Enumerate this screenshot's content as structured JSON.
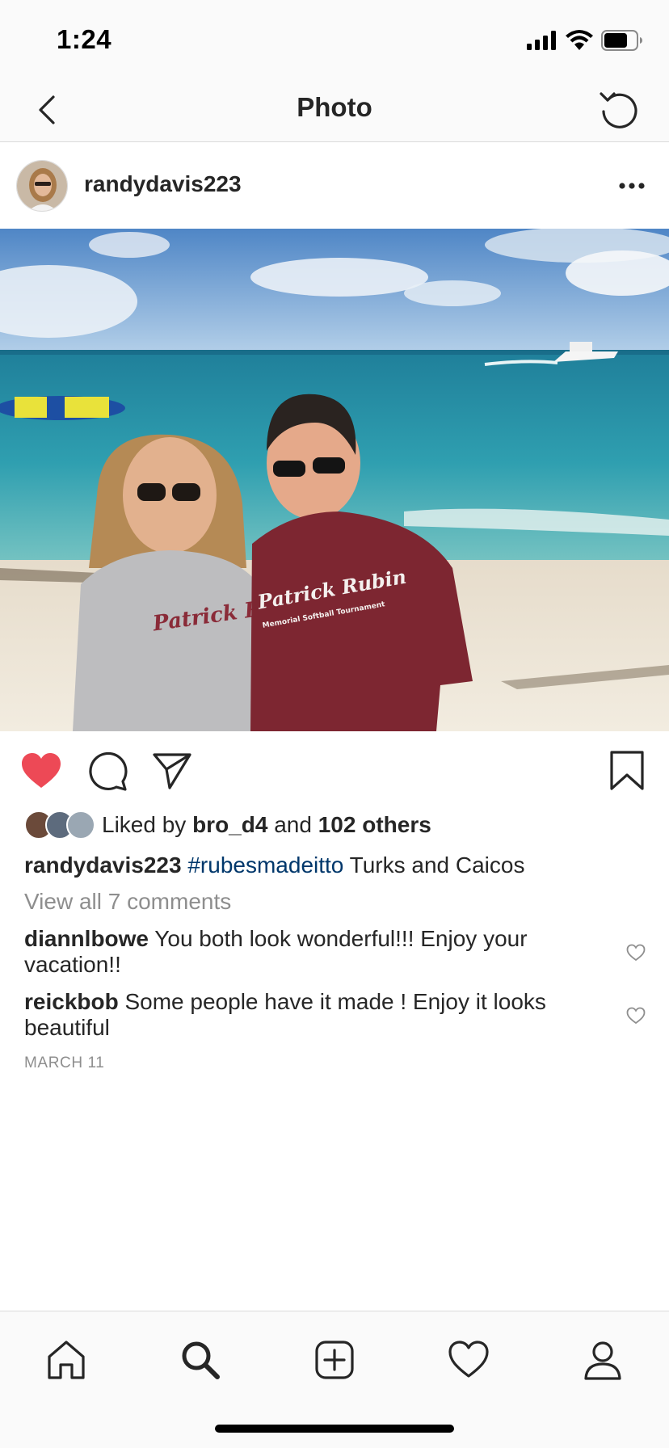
{
  "status_bar": {
    "time": "1:24"
  },
  "nav": {
    "title": "Photo"
  },
  "post": {
    "username": "randydavis223",
    "likes": {
      "prefix": "Liked by",
      "first_liker": "bro_d4",
      "joiner": "and",
      "others": "102 others"
    },
    "caption": {
      "user": "randydavis223",
      "hashtag": "#rubesmadeitto",
      "text": "Turks and Caicos"
    },
    "view_all_comments": "View all 7 comments",
    "comments": [
      {
        "user": "diannlbowe",
        "text": "You both look wonderful!!! Enjoy your vacation!!"
      },
      {
        "user": "reickbob",
        "text": "Some people have it made ! Enjoy it looks beautiful"
      }
    ],
    "date": "MARCH 11",
    "photo_shirt_text": {
      "line1": "Patrick Rubin",
      "line2": "Memorial Softball Tournament"
    }
  },
  "colors": {
    "like_red": "#ed4956",
    "hashtag_blue": "#00376b",
    "meta_gray": "#8e8e8e"
  },
  "icons": {
    "nav": [
      "chevron-left-icon",
      "refresh-icon"
    ],
    "actions": [
      "heart-filled-icon",
      "comment-icon",
      "share-icon",
      "bookmark-icon"
    ],
    "tabs": [
      "home-icon",
      "search-icon",
      "add-post-icon",
      "activity-heart-icon",
      "profile-icon"
    ]
  }
}
